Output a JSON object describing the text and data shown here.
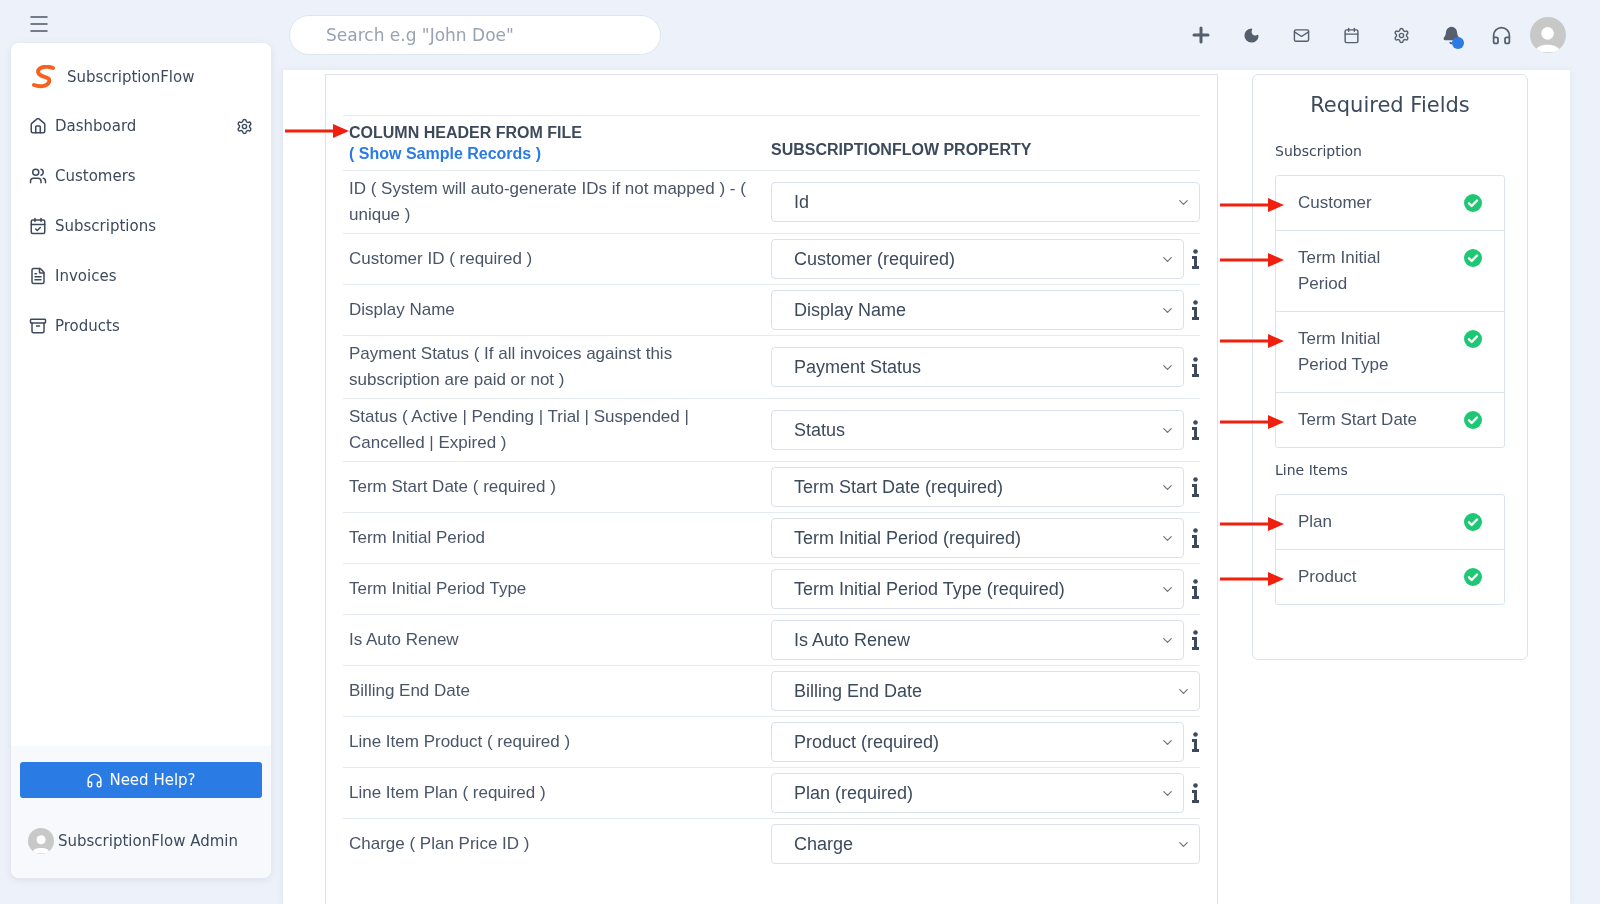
{
  "brand": {
    "name": "SubscriptionFlow"
  },
  "search": {
    "placeholder": "Search e.g \"John Doe\""
  },
  "sidebar": {
    "items": [
      {
        "label": "Dashboard",
        "selected": false
      },
      {
        "label": "Customers",
        "selected": false
      },
      {
        "label": "Subscriptions",
        "selected": false
      },
      {
        "label": "Invoices",
        "selected": false
      },
      {
        "label": "Products",
        "selected": false
      }
    ],
    "help_button": "Need Help?",
    "user": "SubscriptionFlow Admin"
  },
  "mapping": {
    "header_column": "COLUMN HEADER FROM FILE",
    "sample_link": "( Show Sample Records )",
    "property_column": "SUBSCRIPTIONFLOW PROPERTY",
    "rows": [
      {
        "label": "ID ( System will auto-generate IDs if not mapped ) - ( unique )",
        "value": "Id",
        "info": false
      },
      {
        "label": "Customer ID ( required )",
        "value": "Customer (required)",
        "info": true
      },
      {
        "label": "Display Name",
        "value": "Display Name",
        "info": true
      },
      {
        "label": "Payment Status ( If all invoices against this subscription are paid or not )",
        "value": "Payment Status",
        "info": true
      },
      {
        "label": "Status ( Active | Pending | Trial | Suspended | Cancelled | Expired )",
        "value": "Status",
        "info": true
      },
      {
        "label": "Term Start Date ( required )",
        "value": "Term Start Date (required)",
        "info": true
      },
      {
        "label": "Term Initial Period",
        "value": "Term Initial Period (required)",
        "info": true
      },
      {
        "label": "Term Initial Period Type",
        "value": "Term Initial Period Type (required)",
        "info": true
      },
      {
        "label": "Is Auto Renew",
        "value": "Is Auto Renew",
        "info": true
      },
      {
        "label": "Billing End Date",
        "value": "Billing End Date",
        "info": false
      },
      {
        "label": "Line Item Product ( required )",
        "value": "Product (required)",
        "info": true
      },
      {
        "label": "Line Item Plan ( required )",
        "value": "Plan (required)",
        "info": true
      },
      {
        "label": "Charge ( Plan Price ID )",
        "value": "Charge",
        "info": false
      }
    ]
  },
  "required_fields": {
    "title": "Required Fields",
    "groups": [
      {
        "name": "Subscription",
        "items": [
          {
            "label": "Customer",
            "checked": true
          },
          {
            "label": "Term Initial Period",
            "checked": true
          },
          {
            "label": "Term Initial Period Type",
            "checked": true
          },
          {
            "label": "Term Start Date",
            "checked": true
          }
        ]
      },
      {
        "name": "Line Items",
        "items": [
          {
            "label": "Plan",
            "checked": true
          },
          {
            "label": "Product",
            "checked": true
          }
        ]
      }
    ]
  }
}
